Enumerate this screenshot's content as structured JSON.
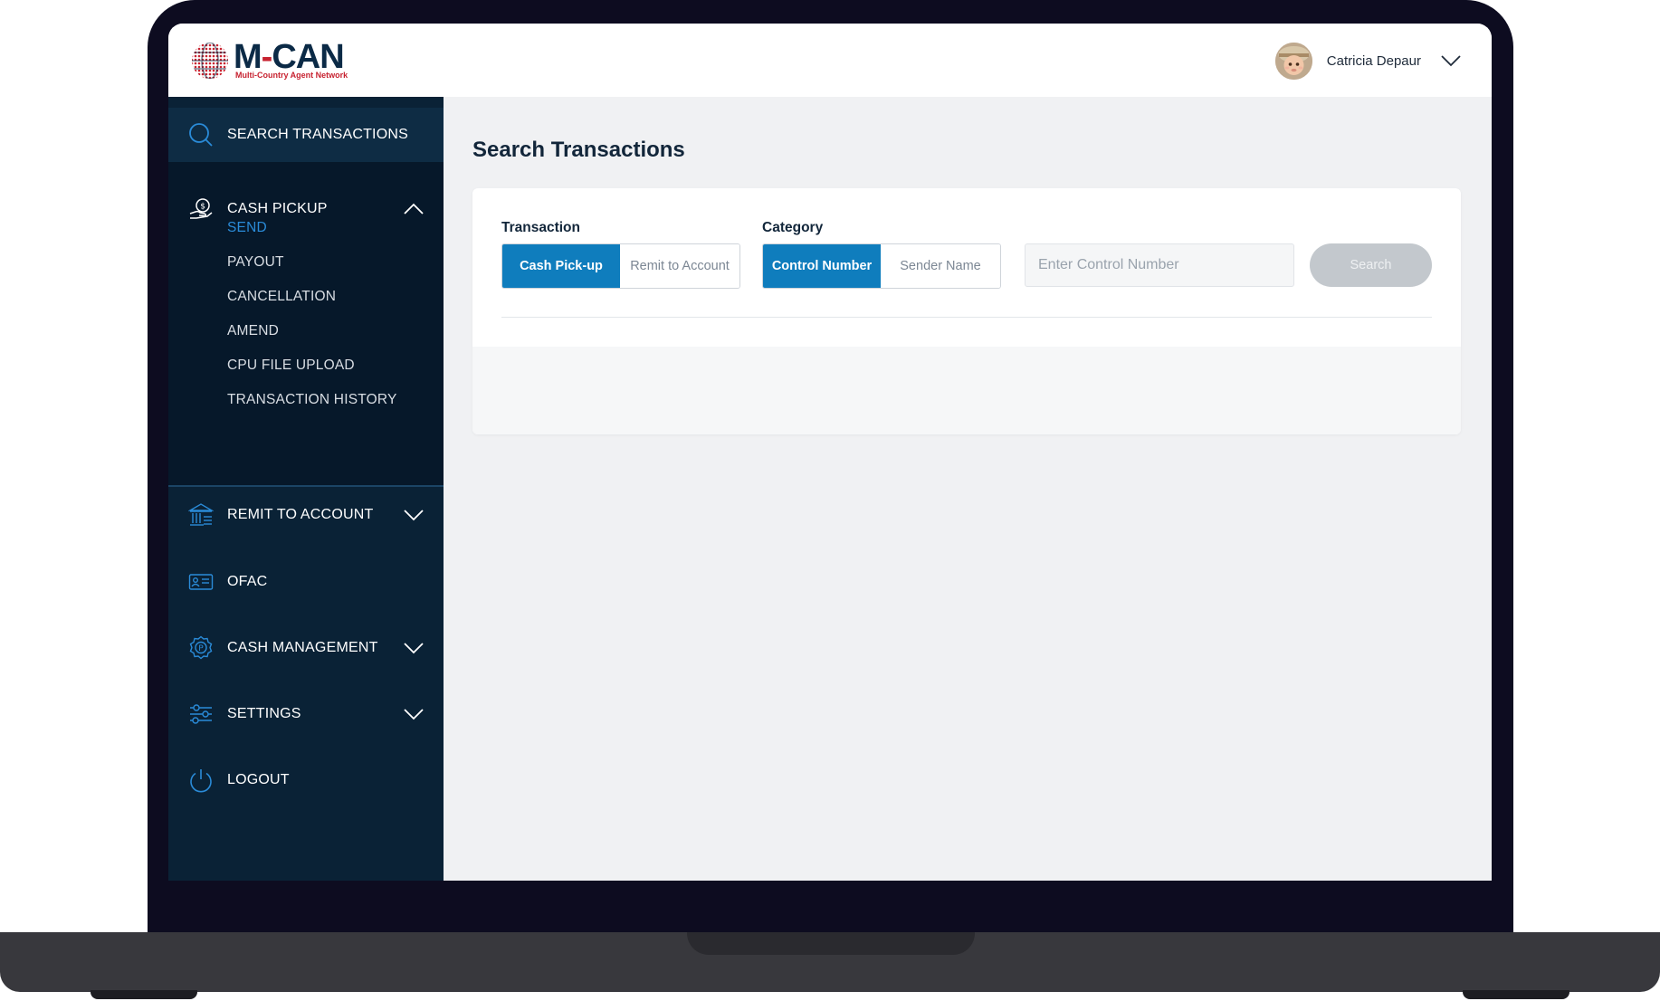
{
  "brand": {
    "name_left": "M",
    "name_dash": "-",
    "name_right": "CAN",
    "tagline": "Multi-Country Agent Network"
  },
  "user": {
    "name": "Catricia Depaur"
  },
  "sidebar": {
    "search_transactions": "SEARCH TRANSACTIONS",
    "cash_pickup": {
      "label": "CASH PICKUP",
      "expanded": true,
      "items": [
        "SEND",
        "PAYOUT",
        "CANCELLATION",
        "AMEND",
        "CPU FILE UPLOAD",
        "TRANSACTION HISTORY"
      ],
      "active": "SEND"
    },
    "remit_to_account": "REMIT TO ACCOUNT",
    "ofac": "OFAC",
    "cash_management": "CASH MANAGEMENT",
    "settings": "SETTINGS",
    "logout": "LOGOUT"
  },
  "main": {
    "title": "Search Transactions",
    "transaction": {
      "label": "Transaction",
      "options": [
        "Cash Pick-up",
        "Remit to Account"
      ],
      "selected": "Cash Pick-up"
    },
    "category": {
      "label": "Category",
      "options": [
        "Control Number",
        "Sender Name"
      ],
      "selected": "Control Number"
    },
    "search": {
      "placeholder": "Enter Control Number",
      "value": "",
      "button_label": "Search"
    }
  },
  "colors": {
    "sidebar_bg": "#0a2236",
    "submenu_bg": "#06182a",
    "accent_blue": "#0f7dbd",
    "active_link": "#2a8bd8",
    "brand_navy": "#0b2a46",
    "brand_red": "#c72230",
    "disabled_button": "#c3c8cd"
  },
  "icons": {
    "search_transactions": "search-icon",
    "cash_pickup": "cash-hand-icon",
    "remit_to_account": "bank-icon",
    "ofac": "id-card-icon",
    "cash_management": "cash-settings-icon",
    "settings": "sliders-icon",
    "logout": "power-icon",
    "user_menu": "chevron-down-icon"
  }
}
